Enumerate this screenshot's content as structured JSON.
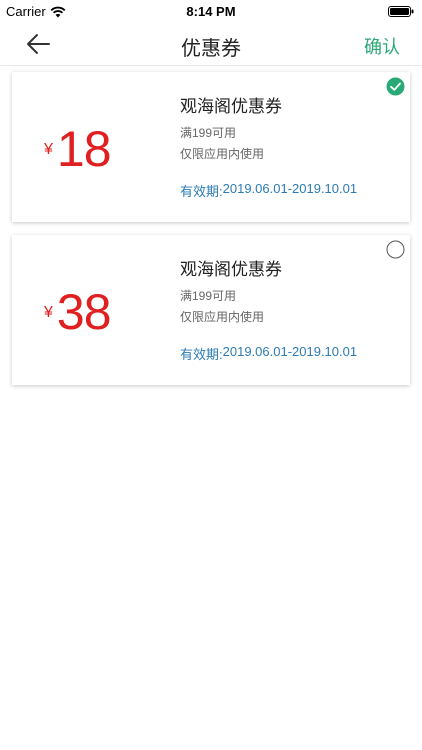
{
  "status_bar": {
    "carrier": "Carrier",
    "time": "8:14 PM",
    "wifi_icon": "wifi-icon",
    "battery_icon": "battery-icon"
  },
  "nav": {
    "title": "优惠券",
    "confirm_label": "确认",
    "back_icon": "back-arrow-icon"
  },
  "colors": {
    "accent_green": "#2aa876",
    "amount_red": "#e02020",
    "validity_blue": "#2c7bb6"
  },
  "coupons": [
    {
      "currency": "¥",
      "amount": "18",
      "title": "观海阁优惠券",
      "condition": "满199可用",
      "scope": "仅限应用内使用",
      "validity_label": "有效期:",
      "validity_range": "2019.06.01-2019.10.01",
      "selected": true
    },
    {
      "currency": "¥",
      "amount": "38",
      "title": "观海阁优惠券",
      "condition": "满199可用",
      "scope": "仅限应用内使用",
      "validity_label": "有效期:",
      "validity_range": "2019.06.01-2019.10.01",
      "selected": false
    }
  ]
}
